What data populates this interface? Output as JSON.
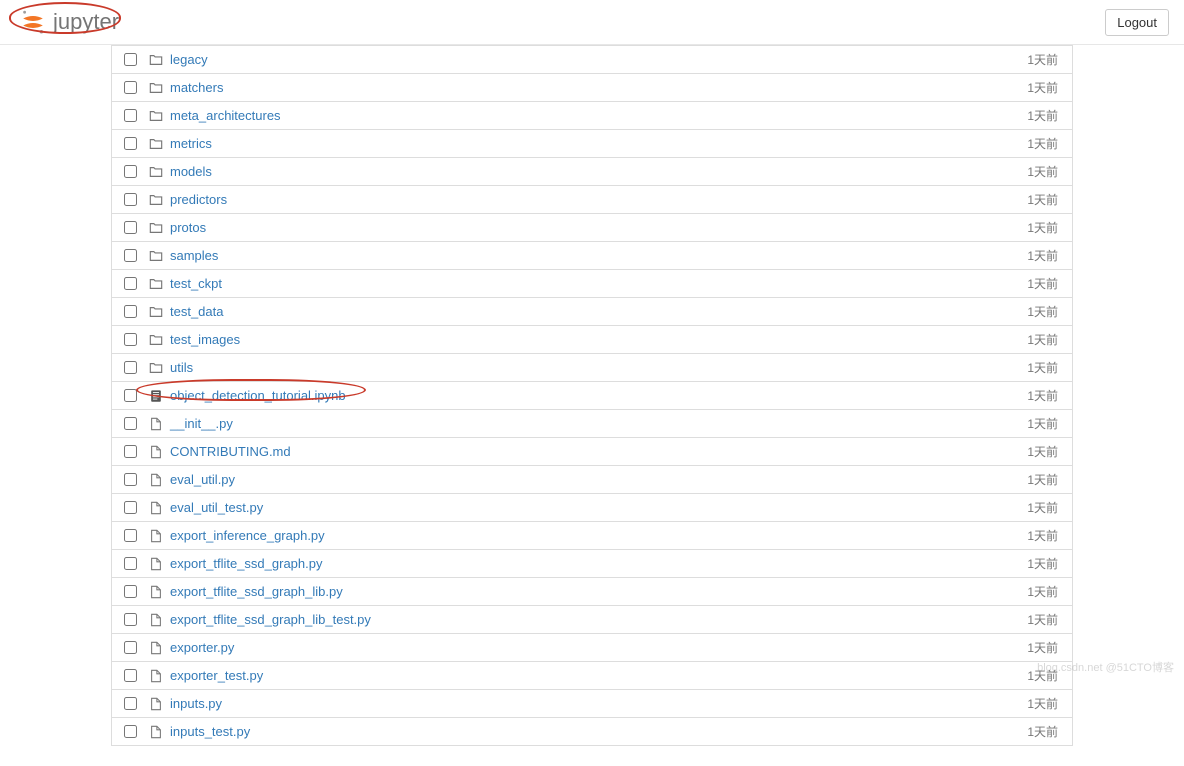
{
  "header": {
    "logo_text": "jupyter",
    "logout_label": "Logout"
  },
  "file_list": [
    {
      "type": "folder",
      "name": "legacy",
      "modified": "1天前"
    },
    {
      "type": "folder",
      "name": "matchers",
      "modified": "1天前"
    },
    {
      "type": "folder",
      "name": "meta_architectures",
      "modified": "1天前"
    },
    {
      "type": "folder",
      "name": "metrics",
      "modified": "1天前"
    },
    {
      "type": "folder",
      "name": "models",
      "modified": "1天前"
    },
    {
      "type": "folder",
      "name": "predictors",
      "modified": "1天前"
    },
    {
      "type": "folder",
      "name": "protos",
      "modified": "1天前"
    },
    {
      "type": "folder",
      "name": "samples",
      "modified": "1天前"
    },
    {
      "type": "folder",
      "name": "test_ckpt",
      "modified": "1天前"
    },
    {
      "type": "folder",
      "name": "test_data",
      "modified": "1天前"
    },
    {
      "type": "folder",
      "name": "test_images",
      "modified": "1天前"
    },
    {
      "type": "folder",
      "name": "utils",
      "modified": "1天前"
    },
    {
      "type": "notebook",
      "name": "object_detection_tutorial.ipynb",
      "modified": "1天前",
      "annotated": true
    },
    {
      "type": "file",
      "name": "__init__.py",
      "modified": "1天前"
    },
    {
      "type": "file",
      "name": "CONTRIBUTING.md",
      "modified": "1天前"
    },
    {
      "type": "file",
      "name": "eval_util.py",
      "modified": "1天前"
    },
    {
      "type": "file",
      "name": "eval_util_test.py",
      "modified": "1天前"
    },
    {
      "type": "file",
      "name": "export_inference_graph.py",
      "modified": "1天前"
    },
    {
      "type": "file",
      "name": "export_tflite_ssd_graph.py",
      "modified": "1天前"
    },
    {
      "type": "file",
      "name": "export_tflite_ssd_graph_lib.py",
      "modified": "1天前"
    },
    {
      "type": "file",
      "name": "export_tflite_ssd_graph_lib_test.py",
      "modified": "1天前"
    },
    {
      "type": "file",
      "name": "exporter.py",
      "modified": "1天前"
    },
    {
      "type": "file",
      "name": "exporter_test.py",
      "modified": "1天前"
    },
    {
      "type": "file",
      "name": "inputs.py",
      "modified": "1天前"
    },
    {
      "type": "file",
      "name": "inputs_test.py",
      "modified": "1天前"
    }
  ],
  "watermark": "blog.csdn.net @51CTO博客"
}
